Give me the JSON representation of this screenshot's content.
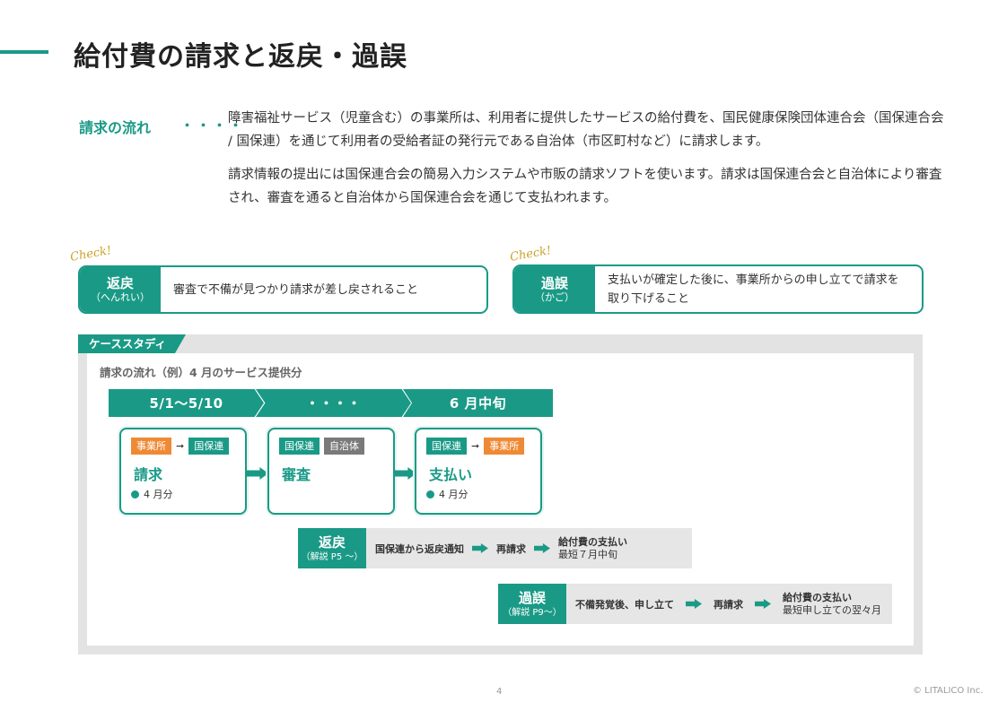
{
  "title": "給付費の請求と返戻・過誤",
  "flow": {
    "label": "請求の流れ",
    "dots": "・・・・",
    "paragraphs": [
      "障害福祉サービス（児童含む）の事業所は、利用者に提供したサービスの給付費を、国民健康保険団体連合会（国保連合会 / 国保連）を通じて利用者の受給者証の発行元である自治体（市区町村など）に請求します。",
      "請求情報の提出には国保連合会の簡易入力システムや市販の請求ソフトを使います。請求は国保連合会と自治体により審査され、審査を通ると自治体から国保連合会を通じて支払われます。"
    ]
  },
  "definitions": [
    {
      "check": "Check!",
      "term": "返戻",
      "reading": "（へんれい）",
      "desc": "審査で不備が見つかり請求が差し戻されること"
    },
    {
      "check": "Check!",
      "term": "過誤",
      "reading": "（かご）",
      "desc": "支払いが確定した後に、事業所からの申し立てで請求を取り下げること"
    }
  ],
  "case_study": {
    "tab": "ケーススタディ",
    "subtitle": "請求の流れ（例）4 月のサービス提供分",
    "phases": [
      "5/1〜5/10",
      "・・・・",
      "6 月中旬"
    ],
    "steps": [
      {
        "from": "事業所",
        "to": "国保連",
        "name": "請求",
        "note": "4 月分"
      },
      {
        "tag1": "国保連",
        "tag2": "自治体",
        "name": "審査"
      },
      {
        "from": "国保連",
        "to": "事業所",
        "name": "支払い",
        "note": "4 月分"
      }
    ],
    "hennrei": {
      "term": "返戻",
      "ref": "（解説 P5 〜）",
      "item1": "国保連から返戻通知",
      "item2": "再請求",
      "item3_title": "給付費の支払い",
      "item3_sub": "最短７月中旬"
    },
    "kago": {
      "term": "過誤",
      "ref": "（解説 P9〜）",
      "item1": "不備発覚後、申し立て",
      "item2": "再請求",
      "item3_title": "給付費の支払い",
      "item3_sub": "最短申し立ての翌々月"
    }
  },
  "footer": {
    "page": "4",
    "copyright": "© LITALICO Inc."
  },
  "colors": {
    "accent": "#1a9a86",
    "orange": "#ee8a35",
    "gray": "#7a7a7a"
  }
}
